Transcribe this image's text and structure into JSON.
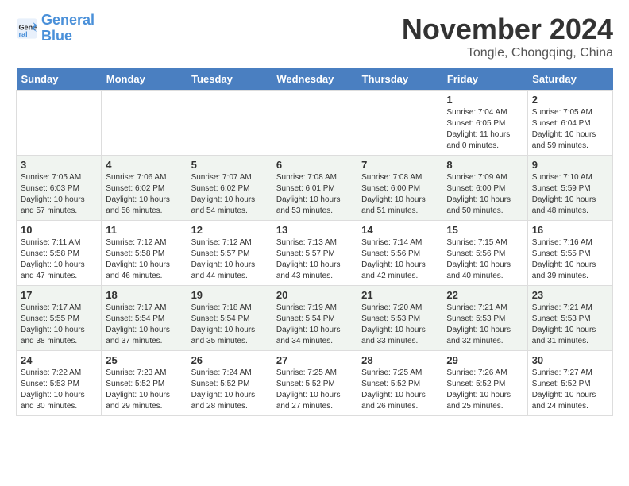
{
  "header": {
    "logo_line1": "General",
    "logo_line2": "Blue",
    "title": "November 2024",
    "location": "Tongle, Chongqing, China"
  },
  "weekdays": [
    "Sunday",
    "Monday",
    "Tuesday",
    "Wednesday",
    "Thursday",
    "Friday",
    "Saturday"
  ],
  "weeks": [
    [
      {
        "day": "",
        "info": ""
      },
      {
        "day": "",
        "info": ""
      },
      {
        "day": "",
        "info": ""
      },
      {
        "day": "",
        "info": ""
      },
      {
        "day": "",
        "info": ""
      },
      {
        "day": "1",
        "info": "Sunrise: 7:04 AM\nSunset: 6:05 PM\nDaylight: 11 hours and 0 minutes."
      },
      {
        "day": "2",
        "info": "Sunrise: 7:05 AM\nSunset: 6:04 PM\nDaylight: 10 hours and 59 minutes."
      }
    ],
    [
      {
        "day": "3",
        "info": "Sunrise: 7:05 AM\nSunset: 6:03 PM\nDaylight: 10 hours and 57 minutes."
      },
      {
        "day": "4",
        "info": "Sunrise: 7:06 AM\nSunset: 6:02 PM\nDaylight: 10 hours and 56 minutes."
      },
      {
        "day": "5",
        "info": "Sunrise: 7:07 AM\nSunset: 6:02 PM\nDaylight: 10 hours and 54 minutes."
      },
      {
        "day": "6",
        "info": "Sunrise: 7:08 AM\nSunset: 6:01 PM\nDaylight: 10 hours and 53 minutes."
      },
      {
        "day": "7",
        "info": "Sunrise: 7:08 AM\nSunset: 6:00 PM\nDaylight: 10 hours and 51 minutes."
      },
      {
        "day": "8",
        "info": "Sunrise: 7:09 AM\nSunset: 6:00 PM\nDaylight: 10 hours and 50 minutes."
      },
      {
        "day": "9",
        "info": "Sunrise: 7:10 AM\nSunset: 5:59 PM\nDaylight: 10 hours and 48 minutes."
      }
    ],
    [
      {
        "day": "10",
        "info": "Sunrise: 7:11 AM\nSunset: 5:58 PM\nDaylight: 10 hours and 47 minutes."
      },
      {
        "day": "11",
        "info": "Sunrise: 7:12 AM\nSunset: 5:58 PM\nDaylight: 10 hours and 46 minutes."
      },
      {
        "day": "12",
        "info": "Sunrise: 7:12 AM\nSunset: 5:57 PM\nDaylight: 10 hours and 44 minutes."
      },
      {
        "day": "13",
        "info": "Sunrise: 7:13 AM\nSunset: 5:57 PM\nDaylight: 10 hours and 43 minutes."
      },
      {
        "day": "14",
        "info": "Sunrise: 7:14 AM\nSunset: 5:56 PM\nDaylight: 10 hours and 42 minutes."
      },
      {
        "day": "15",
        "info": "Sunrise: 7:15 AM\nSunset: 5:56 PM\nDaylight: 10 hours and 40 minutes."
      },
      {
        "day": "16",
        "info": "Sunrise: 7:16 AM\nSunset: 5:55 PM\nDaylight: 10 hours and 39 minutes."
      }
    ],
    [
      {
        "day": "17",
        "info": "Sunrise: 7:17 AM\nSunset: 5:55 PM\nDaylight: 10 hours and 38 minutes."
      },
      {
        "day": "18",
        "info": "Sunrise: 7:17 AM\nSunset: 5:54 PM\nDaylight: 10 hours and 37 minutes."
      },
      {
        "day": "19",
        "info": "Sunrise: 7:18 AM\nSunset: 5:54 PM\nDaylight: 10 hours and 35 minutes."
      },
      {
        "day": "20",
        "info": "Sunrise: 7:19 AM\nSunset: 5:54 PM\nDaylight: 10 hours and 34 minutes."
      },
      {
        "day": "21",
        "info": "Sunrise: 7:20 AM\nSunset: 5:53 PM\nDaylight: 10 hours and 33 minutes."
      },
      {
        "day": "22",
        "info": "Sunrise: 7:21 AM\nSunset: 5:53 PM\nDaylight: 10 hours and 32 minutes."
      },
      {
        "day": "23",
        "info": "Sunrise: 7:21 AM\nSunset: 5:53 PM\nDaylight: 10 hours and 31 minutes."
      }
    ],
    [
      {
        "day": "24",
        "info": "Sunrise: 7:22 AM\nSunset: 5:53 PM\nDaylight: 10 hours and 30 minutes."
      },
      {
        "day": "25",
        "info": "Sunrise: 7:23 AM\nSunset: 5:52 PM\nDaylight: 10 hours and 29 minutes."
      },
      {
        "day": "26",
        "info": "Sunrise: 7:24 AM\nSunset: 5:52 PM\nDaylight: 10 hours and 28 minutes."
      },
      {
        "day": "27",
        "info": "Sunrise: 7:25 AM\nSunset: 5:52 PM\nDaylight: 10 hours and 27 minutes."
      },
      {
        "day": "28",
        "info": "Sunrise: 7:25 AM\nSunset: 5:52 PM\nDaylight: 10 hours and 26 minutes."
      },
      {
        "day": "29",
        "info": "Sunrise: 7:26 AM\nSunset: 5:52 PM\nDaylight: 10 hours and 25 minutes."
      },
      {
        "day": "30",
        "info": "Sunrise: 7:27 AM\nSunset: 5:52 PM\nDaylight: 10 hours and 24 minutes."
      }
    ]
  ],
  "colors": {
    "header_bg": "#4a7fc1",
    "header_text": "#ffffff",
    "row_even": "#f0f4f0",
    "row_odd": "#ffffff",
    "cell_border": "#dddddd"
  }
}
